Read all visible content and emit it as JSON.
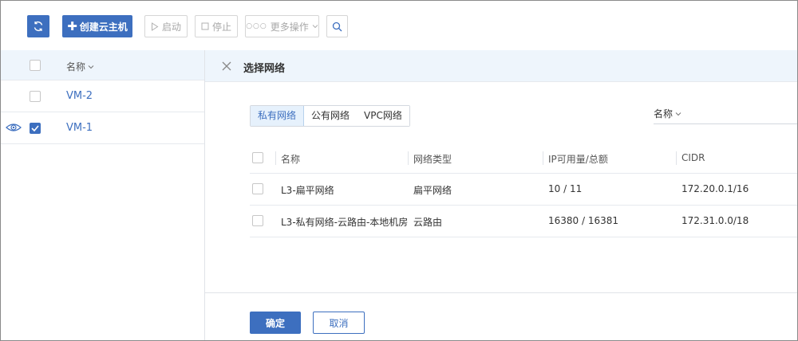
{
  "toolbar": {
    "create_label": "创建云主机",
    "start_label": "启动",
    "stop_label": "停止",
    "more_label": "更多操作"
  },
  "vm_list": {
    "header_label": "名称",
    "rows": [
      {
        "name": "VM-2",
        "checked": false
      },
      {
        "name": "VM-1",
        "checked": true
      }
    ]
  },
  "drawer": {
    "title": "选择网络",
    "tabs": [
      {
        "label": "私有网络",
        "active": true
      },
      {
        "label": "公有网络",
        "active": false
      },
      {
        "label": "VPC网络",
        "active": false
      }
    ],
    "sort_label": "名称",
    "table": {
      "columns": [
        "名称",
        "网络类型",
        "IP可用量/总额",
        "CIDR"
      ],
      "rows": [
        [
          "L3-扁平网络",
          "扁平网络",
          "10 / 11",
          "172.20.0.1/16"
        ],
        [
          "L3-私有网络-云路由-本地机房",
          "云路由",
          "16380 / 16381",
          "172.31.0.0/18"
        ]
      ]
    },
    "ok_label": "确定",
    "cancel_label": "取消"
  },
  "colors": {
    "primary": "#3d6fbf",
    "header_bg": "#eef5fc",
    "tab_active_bg": "#e6f1fc"
  }
}
